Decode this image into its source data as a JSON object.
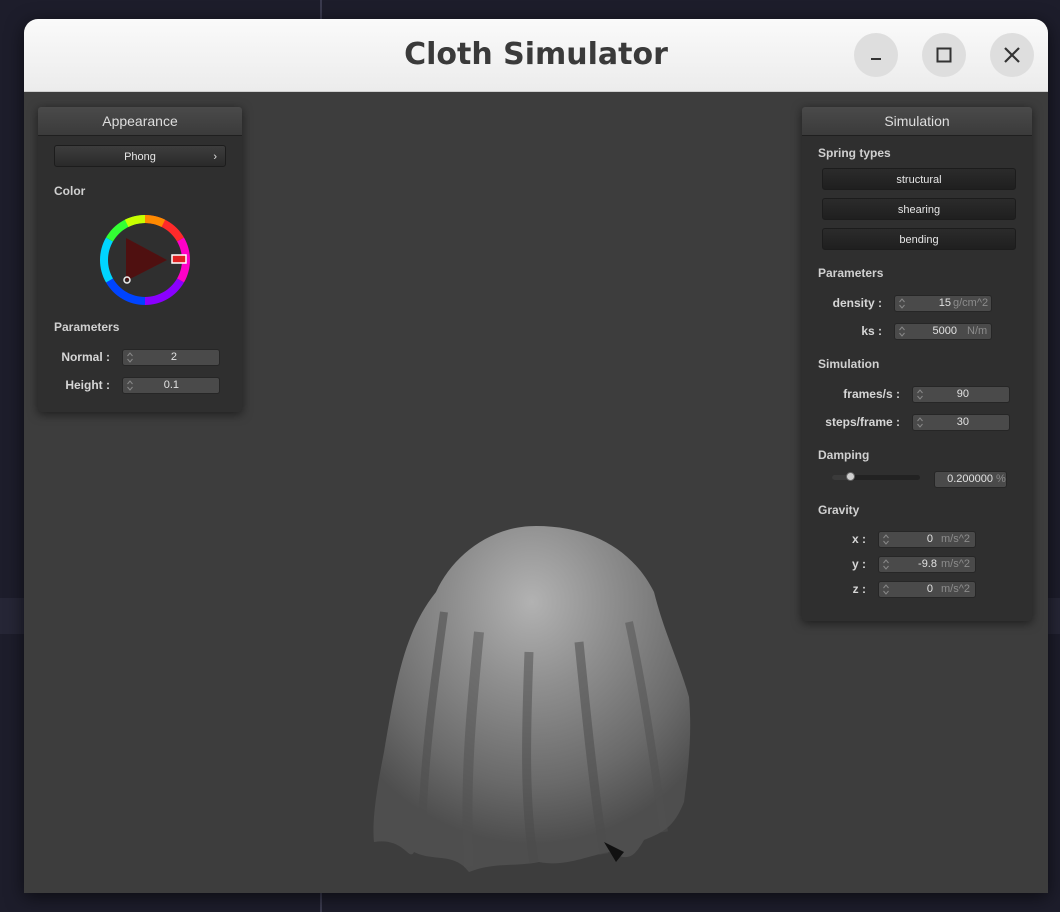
{
  "window": {
    "title": "Cloth Simulator"
  },
  "appearance": {
    "title": "Appearance",
    "shader": "Phong",
    "color_label": "Color",
    "parameters_label": "Parameters",
    "normal_label": "Normal :",
    "normal_value": "2",
    "height_label": "Height :",
    "height_value": "0.1",
    "selected_color": "#e02222"
  },
  "simulation": {
    "title": "Simulation",
    "spring_types_label": "Spring types",
    "spring_types": [
      "structural",
      "shearing",
      "bending"
    ],
    "parameters_label": "Parameters",
    "density_label": "density :",
    "density_value": "15",
    "density_unit": "g/cm^2",
    "ks_label": "ks :",
    "ks_value": "5000",
    "ks_unit": "N/m",
    "simulation_label": "Simulation",
    "fps_label": "frames/s :",
    "fps_value": "90",
    "steps_label": "steps/frame :",
    "steps_value": "30",
    "damping_label": "Damping",
    "damping_value": "0.200000",
    "damping_unit": "%",
    "damping_fraction": 0.2,
    "gravity_label": "Gravity",
    "gx_label": "x :",
    "gx_value": "0",
    "gy_label": "y :",
    "gy_value": "-9.8",
    "gz_label": "z :",
    "gz_value": "0",
    "gravity_unit": "m/s^2"
  },
  "icons": {
    "minimize": "minimize-icon",
    "maximize": "maximize-icon",
    "close": "close-icon",
    "spin": "spinner-arrows-icon",
    "submenu": "chevron-right-icon"
  }
}
